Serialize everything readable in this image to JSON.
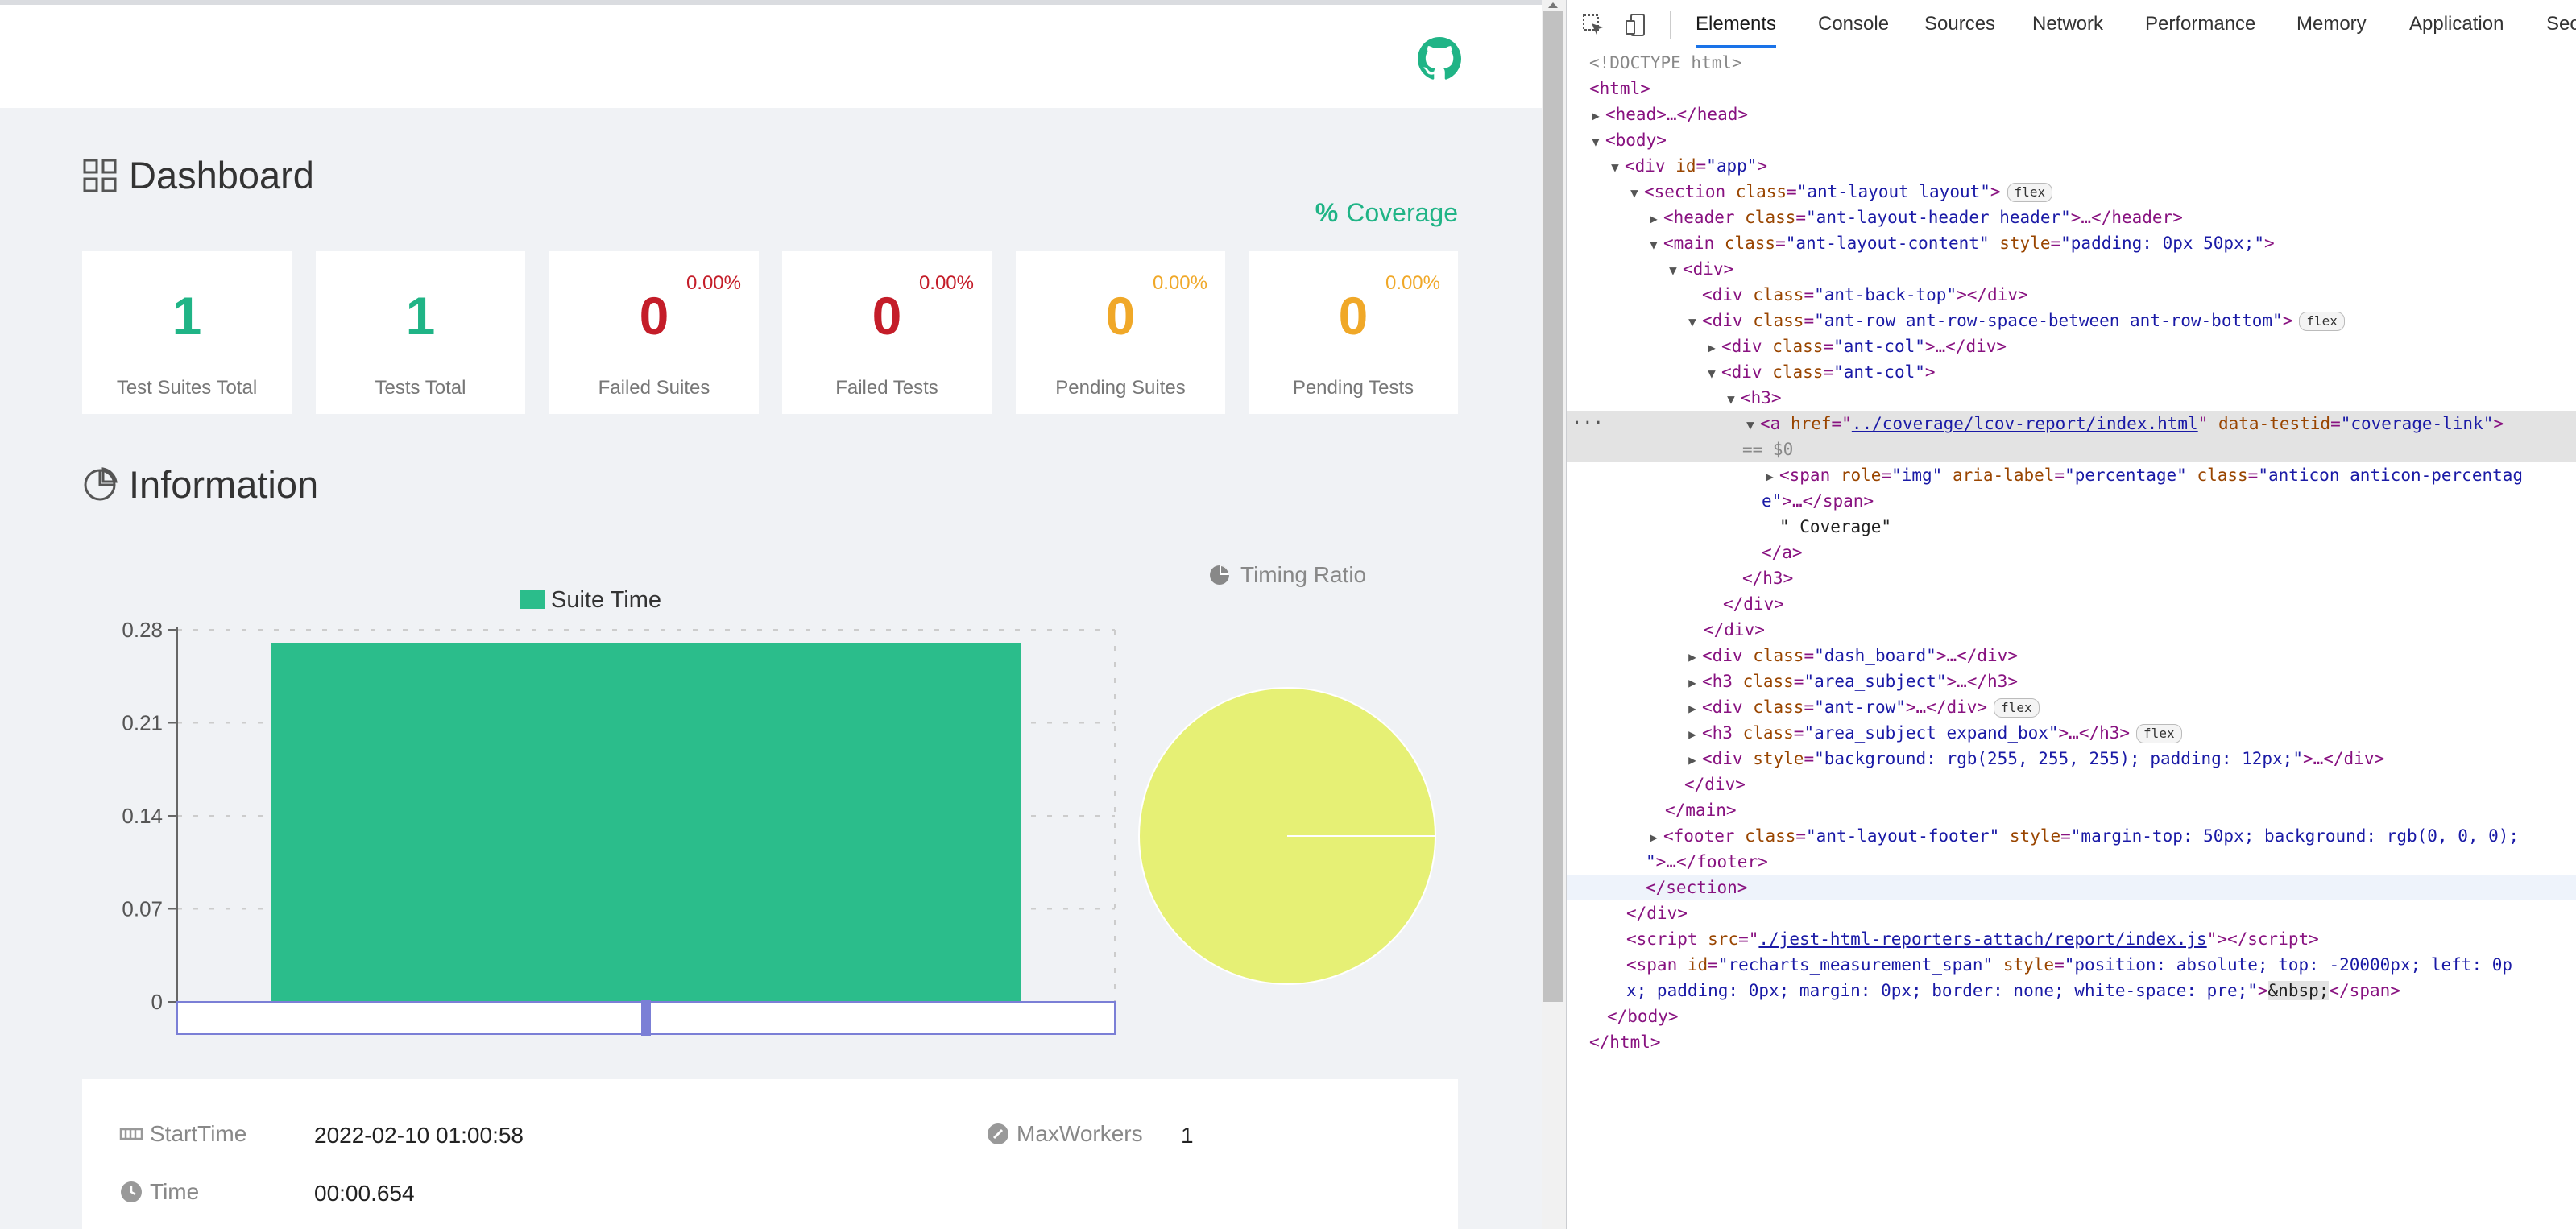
{
  "app": {
    "dashboard_title": "Dashboard",
    "coverage_link": "Coverage",
    "coverage_symbol": "%",
    "cards": [
      {
        "value": "1",
        "label": "Test Suites Total",
        "ratio": "",
        "color": "#20b486"
      },
      {
        "value": "1",
        "label": "Tests Total",
        "ratio": "",
        "color": "#20b486"
      },
      {
        "value": "0",
        "label": "Failed Suites",
        "ratio": "0.00%",
        "color": "#c41d29"
      },
      {
        "value": "0",
        "label": "Failed Tests",
        "ratio": "0.00%",
        "color": "#c41d29"
      },
      {
        "value": "0",
        "label": "Pending Suites",
        "ratio": "0.00%",
        "color": "#f0a828"
      },
      {
        "value": "0",
        "label": "Pending Tests",
        "ratio": "0.00%",
        "color": "#f0a828"
      }
    ],
    "information_title": "Information",
    "timing_ratio_label": "Timing Ratio",
    "meta": {
      "start_time_label": "StartTime",
      "start_time_value": "2022-02-10 01:00:58",
      "time_label": "Time",
      "time_value": "00:00.654",
      "max_workers_label": "MaxWorkers",
      "max_workers_value": "1"
    },
    "colors": {
      "accent_green": "#20b486",
      "failed_red": "#c41d29",
      "pending_amber": "#f0a828",
      "pie_yellow": "#e6f075"
    }
  },
  "chart_data": [
    {
      "type": "bar",
      "categories": [
        ""
      ],
      "series": [
        {
          "name": "Suite Time",
          "values": [
            0.27
          ]
        }
      ],
      "yticks": [
        "0",
        "0.07",
        "0.14",
        "0.21",
        "0.28"
      ],
      "ylim": [
        0,
        0.28
      ],
      "grid": true,
      "legend": "top-center",
      "color": "#2bbd8b"
    },
    {
      "type": "pie",
      "slices": [
        {
          "label": "",
          "value": 1
        }
      ],
      "color": "#e6f075"
    }
  ],
  "devtools": {
    "tabs": [
      "Elements",
      "Console",
      "Sources",
      "Network",
      "Performance",
      "Memory",
      "Application",
      "Sec"
    ],
    "active_tab": "Elements",
    "selected_suffix": "== $0",
    "lines": {
      "l1": "<!DOCTYPE html>",
      "l2": "<html>",
      "l3": "<head>…</head>",
      "l4": "<body>",
      "l5_tag": "<div ",
      "l5_an": "id",
      "l5_av": "\"app\"",
      "l6_an": "class",
      "l6_av": "\"ant-layout layout\"",
      "badge": "flex",
      "l7_av": "\"ant-layout-header header\"",
      "l8_av": "\"ant-layout-content\"",
      "l8_an2": "style",
      "l8_av2": "\"padding: 0px 50px;\"",
      "l10_av": "\"ant-back-top\"",
      "l11_av": "\"ant-row ant-row-space-between ant-row-bottom\"",
      "l12_av": "\"ant-col\"",
      "l14_href": "../coverage/lcov-report/index.html",
      "l14_an2": "data-testid",
      "l14_av2": "\"coverage-link\"",
      "l16_role": "\"img\"",
      "l16_aria": "\"percentage\"",
      "l16_class": "\"anticon anticon-percentag",
      "l16_cont": "e\"",
      "l17_text": "\" Coverage\"",
      "l22_av": "\"dash_board\"",
      "l23_av": "\"area_subject\"",
      "l24_av": "\"ant-row\"",
      "l25_av": "\"area_subject expand_box\"",
      "l26_av": "\"background: rgb(255, 255, 255); padding: 12px;\"",
      "l29_av": "\"ant-layout-footer\"",
      "l29_av2": "\"margin-top: 50px; background: rgb(0, 0, 0);",
      "l31_src": "./jest-html-reporters-attach/report/index.js",
      "l32_id": "\"recharts_measurement_span\"",
      "l32_style": "\"position: absolute; top: -20000px; left: 0p",
      "l32_cont": "x; padding: 0px; margin: 0px; border: none; white-space: pre;\"",
      "nbsp": "&nbsp;"
    }
  }
}
